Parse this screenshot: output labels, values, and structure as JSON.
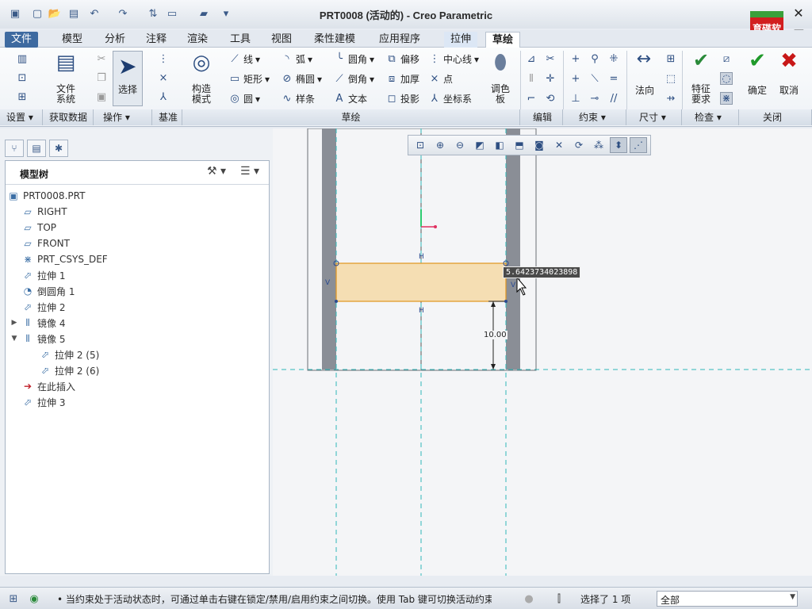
{
  "window": {
    "title": "PRT0008 (活动的) - Creo Parametric",
    "logo_text": "育碟软件",
    "minimize": "—",
    "maximize": "❐",
    "close": "✕"
  },
  "tabs": [
    "文件",
    "模型",
    "分析",
    "注释",
    "渲染",
    "工具",
    "视图",
    "柔性建模",
    "应用程序",
    "拉伸",
    "草绘"
  ],
  "ribbon": {
    "file_system_label": "文件\n系统",
    "select_label": "选择",
    "construct_label": "构造\n模式",
    "palette_label": "调色\n板",
    "normal_label": "法向",
    "feature_req_label": "特征\n要求",
    "ok_label": "确定",
    "cancel_label": "取消",
    "sketch_tools": {
      "line": "线",
      "arc": "弧",
      "fillet": "圆角",
      "offset": "偏移",
      "centerline": "中心线",
      "rectangle": "矩形",
      "ellipse": "椭圆",
      "chamfer": "倒角",
      "thicken": "加厚",
      "point": "点",
      "circle": "圆",
      "spline": "样条",
      "text": "文本",
      "project": "投影",
      "csys": "坐标系"
    },
    "groups": [
      "设置",
      "获取数据",
      "操作",
      "基准",
      "草绘",
      "编辑",
      "约束",
      "尺寸",
      "检查",
      "关闭"
    ]
  },
  "model_tree": {
    "title": "模型树",
    "items": [
      {
        "label": "PRT0008.PRT",
        "icon": "part-icon"
      },
      {
        "label": "RIGHT",
        "icon": "datum-plane-icon"
      },
      {
        "label": "TOP",
        "icon": "datum-plane-icon"
      },
      {
        "label": "FRONT",
        "icon": "datum-plane-icon"
      },
      {
        "label": "PRT_CSYS_DEF",
        "icon": "csys-icon"
      },
      {
        "label": "拉伸 1",
        "icon": "extrude-icon"
      },
      {
        "label": "倒圆角 1",
        "icon": "round-icon"
      },
      {
        "label": "拉伸 2",
        "icon": "extrude-icon"
      },
      {
        "label": "镜像 4",
        "icon": "mirror-icon"
      },
      {
        "label": "镜像 5",
        "icon": "mirror-icon"
      },
      {
        "label": "拉伸 2 (5)",
        "icon": "extrude-icon"
      },
      {
        "label": "拉伸 2 (6)",
        "icon": "extrude-icon"
      },
      {
        "label": "在此插入",
        "icon": "insert-arrow-icon"
      },
      {
        "label": "拉伸 3",
        "icon": "extrude-new-icon"
      }
    ]
  },
  "graphics": {
    "dimension_tip": "5.6423734023898",
    "dimension_label": "10.00",
    "constraint_h": "H",
    "constraint_v": "V"
  },
  "status": {
    "message": "• 当约束处于活动状态时，可通过单击右键在锁定/禁用/启用约束之间切换。使用 Tab 键可切换活动约束。按住",
    "selection": "选择了 1 项",
    "filter": "全部"
  },
  "colors": {
    "sketch_fill": "#f5deb3",
    "sketch_edge": "#e0961e",
    "wall": "#8a8e96",
    "dashed": "#2fb8b8",
    "file_tab": "#3e6aa0"
  }
}
